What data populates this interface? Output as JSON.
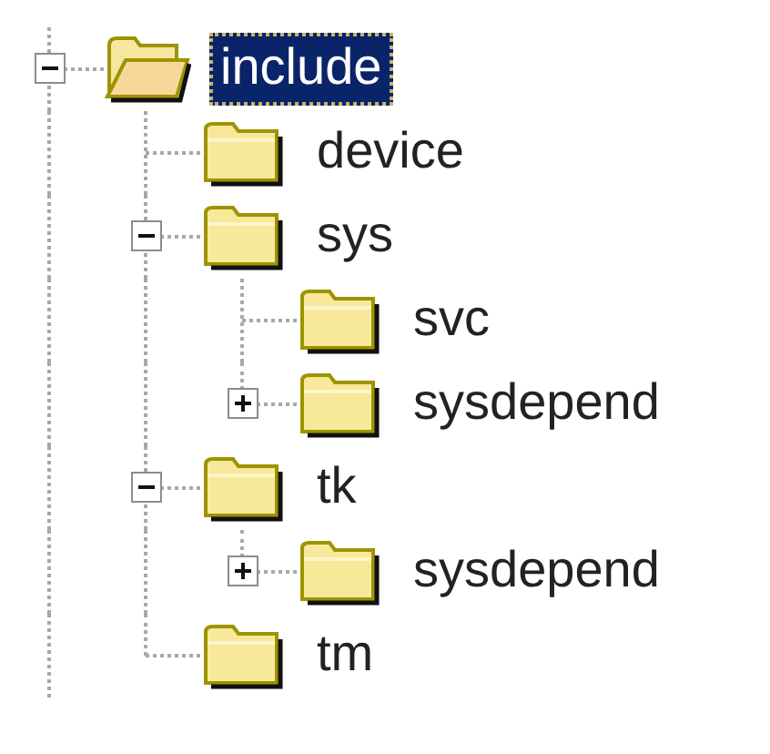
{
  "tree": [
    {
      "label": "include",
      "selected": true,
      "expanded": true,
      "children": [
        {
          "label": "device",
          "selected": false
        },
        {
          "label": "sys",
          "selected": false,
          "expanded": true,
          "children": [
            {
              "label": "svc",
              "selected": false
            },
            {
              "label": "sysdepend",
              "selected": false,
              "expanded": false
            }
          ]
        },
        {
          "label": "tk",
          "selected": false,
          "expanded": true,
          "children": [
            {
              "label": "sysdepend",
              "selected": false,
              "expanded": false
            }
          ]
        },
        {
          "label": "tm",
          "selected": false
        }
      ]
    }
  ]
}
